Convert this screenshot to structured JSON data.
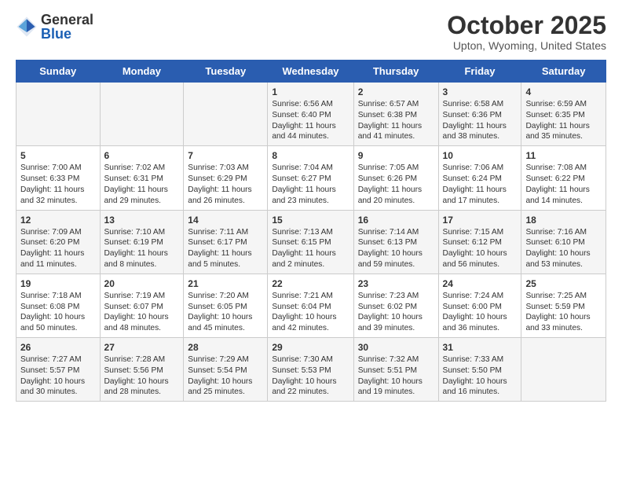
{
  "header": {
    "logo": {
      "general": "General",
      "blue": "Blue"
    },
    "title": "October 2025",
    "location": "Upton, Wyoming, United States"
  },
  "weekdays": [
    "Sunday",
    "Monday",
    "Tuesday",
    "Wednesday",
    "Thursday",
    "Friday",
    "Saturday"
  ],
  "weeks": [
    [
      {
        "day": "",
        "info": ""
      },
      {
        "day": "",
        "info": ""
      },
      {
        "day": "",
        "info": ""
      },
      {
        "day": "1",
        "info": "Sunrise: 6:56 AM\nSunset: 6:40 PM\nDaylight: 11 hours\nand 44 minutes."
      },
      {
        "day": "2",
        "info": "Sunrise: 6:57 AM\nSunset: 6:38 PM\nDaylight: 11 hours\nand 41 minutes."
      },
      {
        "day": "3",
        "info": "Sunrise: 6:58 AM\nSunset: 6:36 PM\nDaylight: 11 hours\nand 38 minutes."
      },
      {
        "day": "4",
        "info": "Sunrise: 6:59 AM\nSunset: 6:35 PM\nDaylight: 11 hours\nand 35 minutes."
      }
    ],
    [
      {
        "day": "5",
        "info": "Sunrise: 7:00 AM\nSunset: 6:33 PM\nDaylight: 11 hours\nand 32 minutes."
      },
      {
        "day": "6",
        "info": "Sunrise: 7:02 AM\nSunset: 6:31 PM\nDaylight: 11 hours\nand 29 minutes."
      },
      {
        "day": "7",
        "info": "Sunrise: 7:03 AM\nSunset: 6:29 PM\nDaylight: 11 hours\nand 26 minutes."
      },
      {
        "day": "8",
        "info": "Sunrise: 7:04 AM\nSunset: 6:27 PM\nDaylight: 11 hours\nand 23 minutes."
      },
      {
        "day": "9",
        "info": "Sunrise: 7:05 AM\nSunset: 6:26 PM\nDaylight: 11 hours\nand 20 minutes."
      },
      {
        "day": "10",
        "info": "Sunrise: 7:06 AM\nSunset: 6:24 PM\nDaylight: 11 hours\nand 17 minutes."
      },
      {
        "day": "11",
        "info": "Sunrise: 7:08 AM\nSunset: 6:22 PM\nDaylight: 11 hours\nand 14 minutes."
      }
    ],
    [
      {
        "day": "12",
        "info": "Sunrise: 7:09 AM\nSunset: 6:20 PM\nDaylight: 11 hours\nand 11 minutes."
      },
      {
        "day": "13",
        "info": "Sunrise: 7:10 AM\nSunset: 6:19 PM\nDaylight: 11 hours\nand 8 minutes."
      },
      {
        "day": "14",
        "info": "Sunrise: 7:11 AM\nSunset: 6:17 PM\nDaylight: 11 hours\nand 5 minutes."
      },
      {
        "day": "15",
        "info": "Sunrise: 7:13 AM\nSunset: 6:15 PM\nDaylight: 11 hours\nand 2 minutes."
      },
      {
        "day": "16",
        "info": "Sunrise: 7:14 AM\nSunset: 6:13 PM\nDaylight: 10 hours\nand 59 minutes."
      },
      {
        "day": "17",
        "info": "Sunrise: 7:15 AM\nSunset: 6:12 PM\nDaylight: 10 hours\nand 56 minutes."
      },
      {
        "day": "18",
        "info": "Sunrise: 7:16 AM\nSunset: 6:10 PM\nDaylight: 10 hours\nand 53 minutes."
      }
    ],
    [
      {
        "day": "19",
        "info": "Sunrise: 7:18 AM\nSunset: 6:08 PM\nDaylight: 10 hours\nand 50 minutes."
      },
      {
        "day": "20",
        "info": "Sunrise: 7:19 AM\nSunset: 6:07 PM\nDaylight: 10 hours\nand 48 minutes."
      },
      {
        "day": "21",
        "info": "Sunrise: 7:20 AM\nSunset: 6:05 PM\nDaylight: 10 hours\nand 45 minutes."
      },
      {
        "day": "22",
        "info": "Sunrise: 7:21 AM\nSunset: 6:04 PM\nDaylight: 10 hours\nand 42 minutes."
      },
      {
        "day": "23",
        "info": "Sunrise: 7:23 AM\nSunset: 6:02 PM\nDaylight: 10 hours\nand 39 minutes."
      },
      {
        "day": "24",
        "info": "Sunrise: 7:24 AM\nSunset: 6:00 PM\nDaylight: 10 hours\nand 36 minutes."
      },
      {
        "day": "25",
        "info": "Sunrise: 7:25 AM\nSunset: 5:59 PM\nDaylight: 10 hours\nand 33 minutes."
      }
    ],
    [
      {
        "day": "26",
        "info": "Sunrise: 7:27 AM\nSunset: 5:57 PM\nDaylight: 10 hours\nand 30 minutes."
      },
      {
        "day": "27",
        "info": "Sunrise: 7:28 AM\nSunset: 5:56 PM\nDaylight: 10 hours\nand 28 minutes."
      },
      {
        "day": "28",
        "info": "Sunrise: 7:29 AM\nSunset: 5:54 PM\nDaylight: 10 hours\nand 25 minutes."
      },
      {
        "day": "29",
        "info": "Sunrise: 7:30 AM\nSunset: 5:53 PM\nDaylight: 10 hours\nand 22 minutes."
      },
      {
        "day": "30",
        "info": "Sunrise: 7:32 AM\nSunset: 5:51 PM\nDaylight: 10 hours\nand 19 minutes."
      },
      {
        "day": "31",
        "info": "Sunrise: 7:33 AM\nSunset: 5:50 PM\nDaylight: 10 hours\nand 16 minutes."
      },
      {
        "day": "",
        "info": ""
      }
    ]
  ]
}
